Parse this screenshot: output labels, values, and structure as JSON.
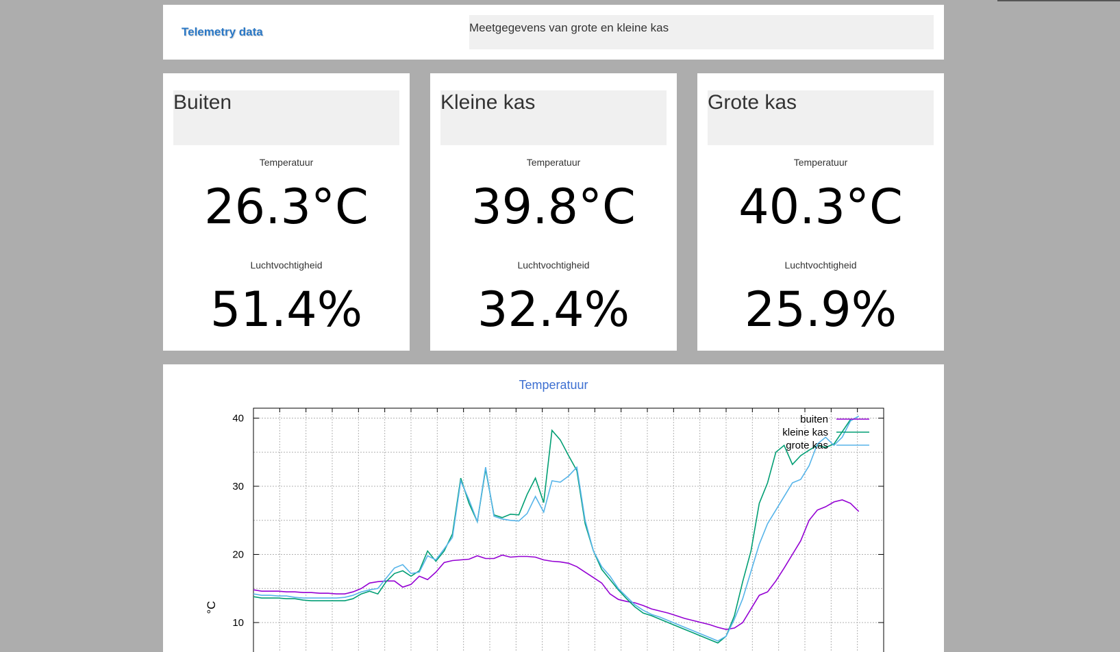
{
  "header": {
    "title": "Telemetry data",
    "description": "Meetgegevens van grote en kleine kas"
  },
  "cards": [
    {
      "title": "Buiten",
      "temp_label": "Temperatuur",
      "temp_value": "26.3°C",
      "hum_label": "Luchtvochtigheid",
      "hum_value": "51.4%"
    },
    {
      "title": "Kleine kas",
      "temp_label": "Temperatuur",
      "temp_value": "39.8°C",
      "hum_label": "Luchtvochtigheid",
      "hum_value": "32.4%"
    },
    {
      "title": "Grote kas",
      "temp_label": "Temperatuur",
      "temp_value": "40.3°C",
      "hum_label": "Luchtvochtigheid",
      "hum_value": "25.9%"
    }
  ],
  "chart_data": {
    "type": "line",
    "title": "Temperatuur",
    "ylabel": "°C",
    "xlabel": "",
    "grid": true,
    "legend": "top-right",
    "ylim": [
      10,
      45
    ],
    "yticks": [
      10,
      20,
      30,
      40
    ],
    "x": [
      0,
      1,
      2,
      3,
      4,
      5,
      6,
      7,
      8,
      9,
      10,
      11,
      12,
      13,
      14,
      15,
      16,
      17,
      18,
      19,
      20,
      21,
      22,
      23,
      24,
      25,
      26,
      27,
      28,
      29,
      30,
      31,
      32,
      33,
      34,
      35,
      36,
      37,
      38,
      39,
      40,
      41,
      42,
      43,
      44,
      45,
      46,
      47,
      48,
      49,
      50,
      51,
      52,
      53,
      54,
      55,
      56,
      57,
      58,
      59,
      60,
      61,
      62,
      63,
      64,
      65,
      66,
      67,
      68,
      69,
      70,
      71,
      72,
      73,
      74,
      75,
      76
    ],
    "series": [
      {
        "name": "buiten",
        "color": "#9400d3",
        "values": [
          14.8,
          14.6,
          14.6,
          14.6,
          14.5,
          14.5,
          14.4,
          14.4,
          14.3,
          14.3,
          14.2,
          14.2,
          14.5,
          15.0,
          15.8,
          16.0,
          16.1,
          16.1,
          15.2,
          15.6,
          16.8,
          16.3,
          17.4,
          18.8,
          19.1,
          19.2,
          19.3,
          19.8,
          19.4,
          19.4,
          19.9,
          19.6,
          19.7,
          19.7,
          19.6,
          19.2,
          19.0,
          18.9,
          18.7,
          18.2,
          17.4,
          16.6,
          15.8,
          14.2,
          13.4,
          13.1,
          12.9,
          12.5,
          12.0,
          11.7,
          11.4,
          11.0,
          10.6,
          10.3,
          10.0,
          9.7,
          9.3,
          9.0,
          9.2,
          10.0,
          12.0,
          14.0,
          14.5,
          16.1,
          18.0,
          20.0,
          22.0,
          25.0,
          26.5,
          27.0,
          27.7,
          28.0,
          27.5,
          26.3,
          null,
          null,
          null
        ]
      },
      {
        "name": "kleine kas",
        "color": "#009e73",
        "values": [
          13.8,
          13.6,
          13.6,
          13.6,
          13.5,
          13.5,
          13.3,
          13.2,
          13.2,
          13.2,
          13.2,
          13.2,
          13.5,
          14.2,
          14.6,
          14.2,
          16.0,
          17.2,
          17.6,
          16.8,
          17.6,
          20.5,
          19.0,
          20.5,
          23.0,
          31.2,
          27.5,
          24.8,
          32.5,
          25.8,
          25.4,
          25.9,
          25.8,
          28.8,
          31.2,
          27.6,
          38.2,
          36.8,
          34.5,
          32.3,
          24.5,
          20.5,
          17.8,
          16.3,
          14.8,
          13.5,
          12.3,
          11.4,
          11.0,
          10.5,
          10.0,
          9.5,
          9.0,
          8.5,
          8.0,
          7.5,
          7.0,
          8.0,
          11.0,
          16.0,
          20.5,
          27.5,
          30.5,
          35.0,
          36.0,
          33.2,
          34.5,
          35.3,
          36.0,
          35.7,
          36.2,
          38.0,
          39.8,
          null,
          null,
          null,
          null
        ]
      },
      {
        "name": "grote kas",
        "color": "#56b4e9",
        "values": [
          14.2,
          14.0,
          14.0,
          13.9,
          13.9,
          13.7,
          13.6,
          13.6,
          13.6,
          13.6,
          13.6,
          13.7,
          14.0,
          14.5,
          14.8,
          15.0,
          16.5,
          18.0,
          18.5,
          17.2,
          17.4,
          19.8,
          19.2,
          20.8,
          22.5,
          30.8,
          28.0,
          24.8,
          32.8,
          25.6,
          25.2,
          25.0,
          24.9,
          26.0,
          28.5,
          26.2,
          30.8,
          30.6,
          31.5,
          32.8,
          25.0,
          20.5,
          18.2,
          16.8,
          15.0,
          13.8,
          12.6,
          11.8,
          11.2,
          10.8,
          10.3,
          9.8,
          9.3,
          8.8,
          8.3,
          7.8,
          7.3,
          8.0,
          10.5,
          13.5,
          17.5,
          21.5,
          24.5,
          26.5,
          28.5,
          30.5,
          31.0,
          33.0,
          36.2,
          37.2,
          36.0,
          37.2,
          39.6,
          40.3,
          null,
          null,
          null
        ]
      }
    ]
  }
}
